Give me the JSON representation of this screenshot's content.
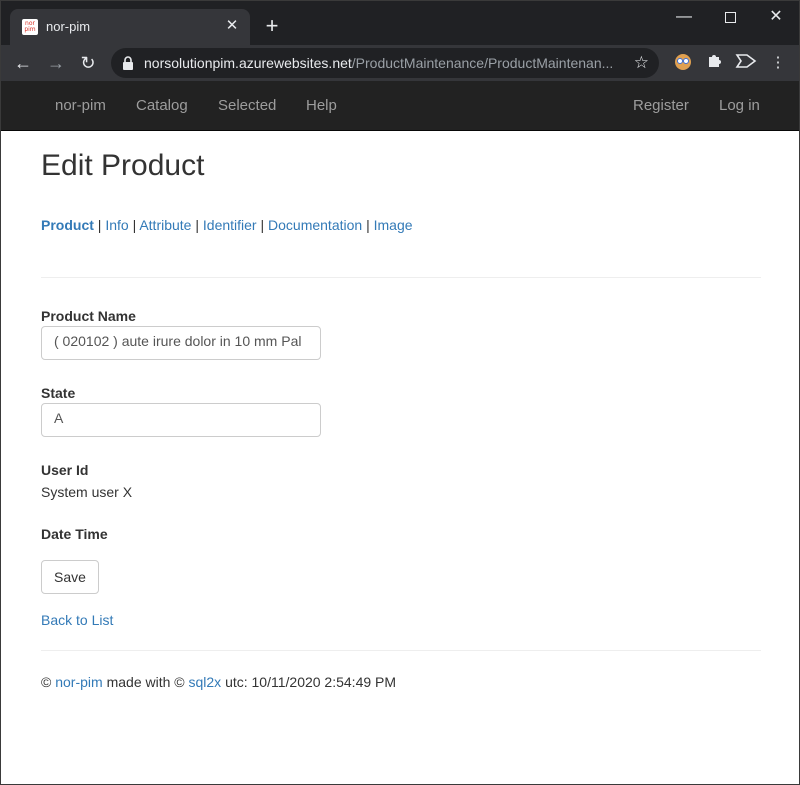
{
  "browser": {
    "tab_title": "nor-pim",
    "favicon_text": "nor pim",
    "url_host": "norsolutionpim.azurewebsites.net",
    "url_path": "/ProductMaintenance/ProductMaintenan..."
  },
  "nav": {
    "brand": "nor-pim",
    "items": [
      "Catalog",
      "Selected",
      "Help"
    ],
    "register": "Register",
    "login": "Log in"
  },
  "page": {
    "title": "Edit Product",
    "subnav": [
      {
        "label": "Product",
        "active": true
      },
      {
        "label": "Info"
      },
      {
        "label": "Attribute"
      },
      {
        "label": "Identifier"
      },
      {
        "label": "Documentation"
      },
      {
        "label": "Image"
      }
    ],
    "subnav_separator": "|"
  },
  "form": {
    "product_name_label": "Product Name",
    "product_name_value": "( 020102 )  aute irure dolor in 10 mm Pal",
    "state_label": "State",
    "state_value": "A",
    "user_id_label": "User Id",
    "user_id_value": "System user X",
    "date_time_label": "Date Time",
    "save_label": "Save",
    "back_link": "Back to List"
  },
  "footer": {
    "copyright": "©",
    "brand_link": "nor-pim",
    "made_with": "made with ©",
    "tool_link": "sql2x",
    "utc_text": "utc: 10/11/2020 2:54:49 PM"
  },
  "colors": {
    "link": "#337ab7",
    "navbar_bg": "#222222",
    "navbar_text": "#9d9d9d"
  }
}
